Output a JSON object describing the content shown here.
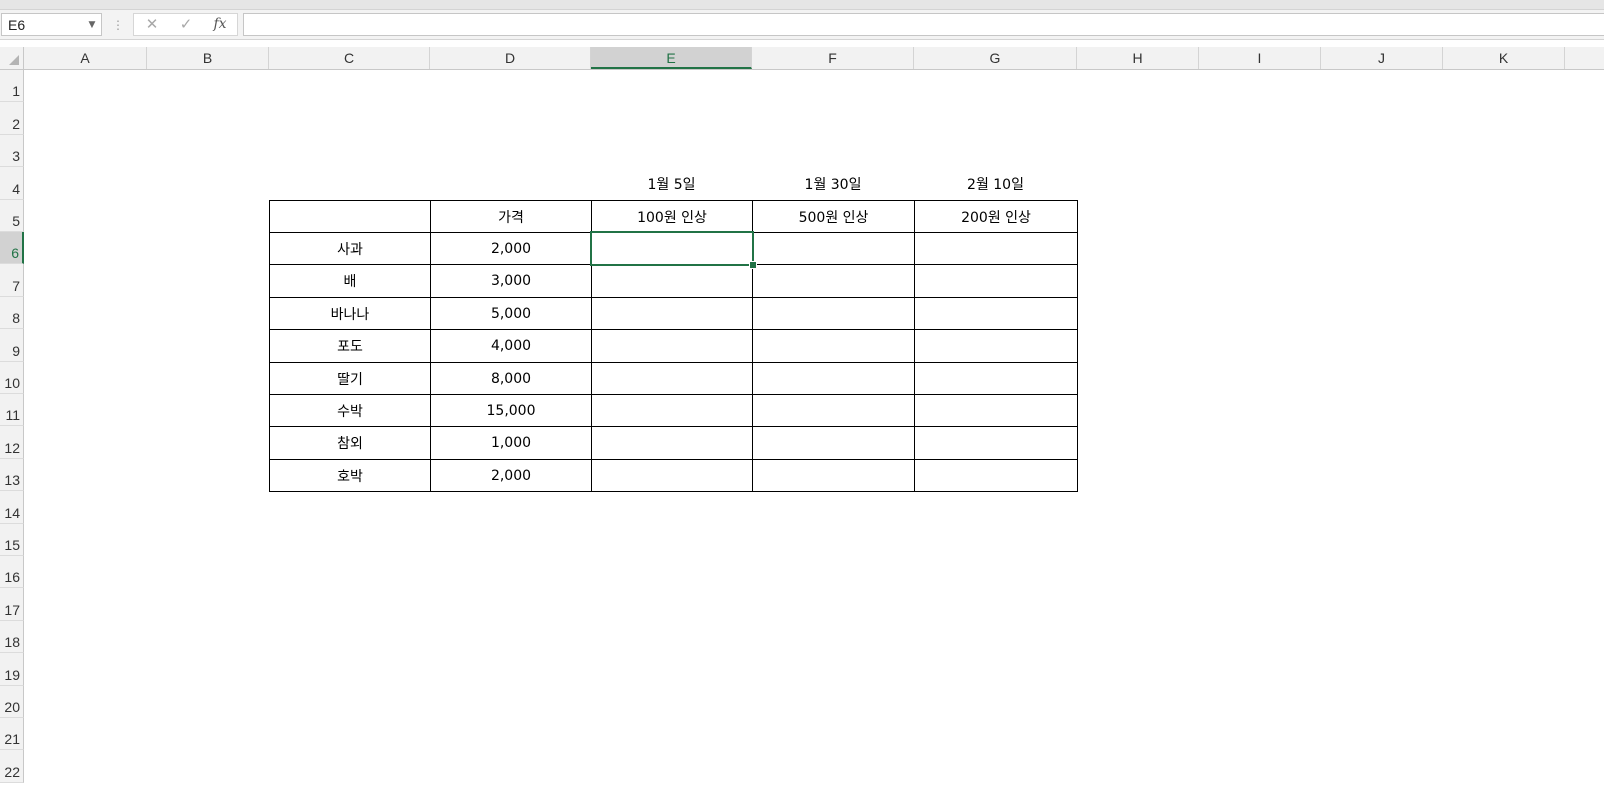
{
  "name_box": {
    "value": "E6"
  },
  "formula_bar": {
    "separator": "⋮",
    "cancel_glyph": "✕",
    "enter_glyph": "✓",
    "fx_label": "fx",
    "value": ""
  },
  "columns": [
    "A",
    "B",
    "C",
    "D",
    "E",
    "F",
    "G",
    "H",
    "I",
    "J",
    "K"
  ],
  "rows": [
    "1",
    "2",
    "3",
    "4",
    "5",
    "6",
    "7",
    "8",
    "9",
    "10",
    "11",
    "12",
    "13",
    "14",
    "15",
    "16",
    "17",
    "18",
    "19",
    "20",
    "21",
    "22"
  ],
  "active_cell": {
    "column": "E",
    "row": "6"
  },
  "sheet": {
    "date_headers": [
      "1월 5일",
      "1월 30일",
      "2월 10일"
    ],
    "table_headers": [
      "",
      "가격",
      "100원 인상",
      "500원 인상",
      "200원 인상"
    ],
    "items": [
      {
        "name": "사과",
        "price": "2,000"
      },
      {
        "name": "배",
        "price": "3,000"
      },
      {
        "name": "바나나",
        "price": "5,000"
      },
      {
        "name": "포도",
        "price": "4,000"
      },
      {
        "name": "딸기",
        "price": "8,000"
      },
      {
        "name": "수박",
        "price": "15,000"
      },
      {
        "name": "참외",
        "price": "1,000"
      },
      {
        "name": "호박",
        "price": "2,000"
      }
    ]
  },
  "colors": {
    "accent": "#217346",
    "header_bg": "#f2f2f2",
    "grid_border": "#000000"
  }
}
